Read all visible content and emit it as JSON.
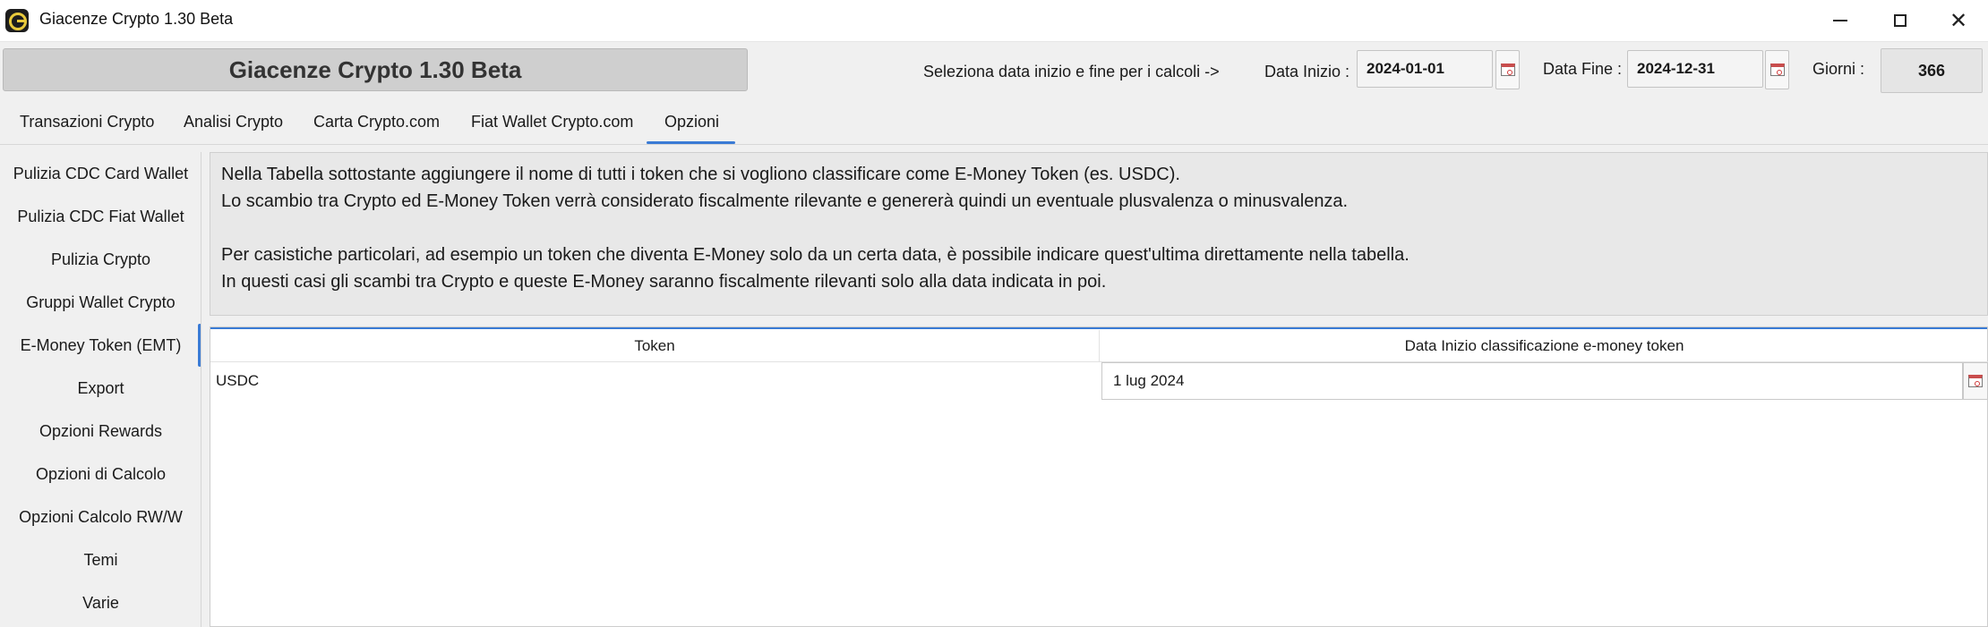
{
  "window": {
    "title": "Giacenze Crypto 1.30 Beta"
  },
  "header": {
    "app_title": "Giacenze Crypto 1.30 Beta",
    "date_hint": "Seleziona data inizio e fine per i calcoli ->",
    "start_label": "Data Inizio :",
    "start_value": "2024-01-01",
    "end_label": "Data Fine :",
    "end_value": "2024-12-31",
    "days_label": "Giorni :",
    "days_value": "366"
  },
  "tabs": [
    {
      "label": "Transazioni Crypto"
    },
    {
      "label": "Analisi Crypto"
    },
    {
      "label": "Carta Crypto.com"
    },
    {
      "label": "Fiat Wallet Crypto.com"
    },
    {
      "label": "Opzioni",
      "active": true
    }
  ],
  "sidebar": {
    "items": [
      {
        "label": "Pulizia CDC Card Wallet"
      },
      {
        "label": "Pulizia CDC Fiat Wallet"
      },
      {
        "label": "Pulizia Crypto"
      },
      {
        "label": "Gruppi Wallet Crypto"
      },
      {
        "label": "E-Money Token (EMT)",
        "active": true
      },
      {
        "label": "Export"
      },
      {
        "label": "Opzioni Rewards"
      },
      {
        "label": "Opzioni di Calcolo"
      },
      {
        "label": "Opzioni Calcolo RW/W"
      },
      {
        "label": "Temi"
      },
      {
        "label": "Varie"
      }
    ]
  },
  "description": {
    "lines": [
      "Nella Tabella sottostante aggiungere il nome di tutti i token che si vogliono classificare come E-Money Token (es. USDC).",
      "Lo scambio tra Crypto ed E-Money Token verrà considerato fiscalmente rilevante e genererà quindi un eventuale plusvalenza o minusvalenza.",
      "",
      "Per casistiche particolari, ad esempio un  token che diventa E-Money solo da un certa data, è possibile indicare quest'ultima direttamente nella tabella.",
      "In questi casi gli scambi tra Crypto e queste E-Money saranno fiscalmente rilevanti solo alla data indicata in poi."
    ]
  },
  "table": {
    "columns": [
      "Token",
      "Data Inizio classificazione e-money token"
    ],
    "rows": [
      {
        "token": "USDC",
        "date": "1 lug 2024"
      }
    ]
  },
  "colors": {
    "accent": "#3a7bd5"
  },
  "icons": {
    "app": "app-logo-icon",
    "calendar": "calendar-icon",
    "minimize": "minimize-icon",
    "maximize": "maximize-icon",
    "close": "close-icon"
  }
}
